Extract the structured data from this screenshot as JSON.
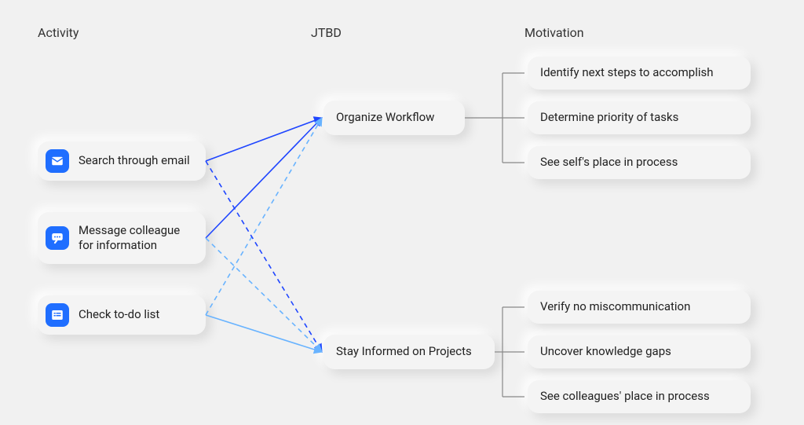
{
  "headers": {
    "activity": "Activity",
    "jtbd": "JTBD",
    "motivation": "Motivation"
  },
  "activities": [
    {
      "label": "Search through email",
      "icon": "mail-icon"
    },
    {
      "label": "Message colleague for information",
      "icon": "chat-icon"
    },
    {
      "label": "Check to-do list",
      "icon": "list-icon"
    }
  ],
  "jtbd": [
    {
      "label": "Organize Workflow"
    },
    {
      "label": "Stay Informed on Projects"
    }
  ],
  "motivations": [
    {
      "label": "Identify next steps to accomplish"
    },
    {
      "label": "Determine priority of tasks"
    },
    {
      "label": "See self's place in process"
    },
    {
      "label": "Verify no miscommunication"
    },
    {
      "label": "Uncover knowledge gaps"
    },
    {
      "label": "See colleagues' place in process"
    }
  ],
  "connections": {
    "activity_to_jtbd": [
      {
        "from": 0,
        "to": 0,
        "color": "#1f46ff",
        "style": "solid"
      },
      {
        "from": 1,
        "to": 0,
        "color": "#1f46ff",
        "style": "solid"
      },
      {
        "from": 2,
        "to": 0,
        "color": "#68b3ff",
        "style": "dashed"
      },
      {
        "from": 0,
        "to": 1,
        "color": "#1f46ff",
        "style": "dashed"
      },
      {
        "from": 1,
        "to": 1,
        "color": "#68b3ff",
        "style": "dashed"
      },
      {
        "from": 2,
        "to": 1,
        "color": "#68b3ff",
        "style": "solid"
      }
    ],
    "jtbd_to_motivation": [
      {
        "from": 0,
        "to": [
          0,
          1,
          2
        ]
      },
      {
        "from": 1,
        "to": [
          3,
          4,
          5
        ]
      }
    ]
  },
  "colors": {
    "icon_bg": "#1f6eff",
    "bracket": "#888"
  }
}
